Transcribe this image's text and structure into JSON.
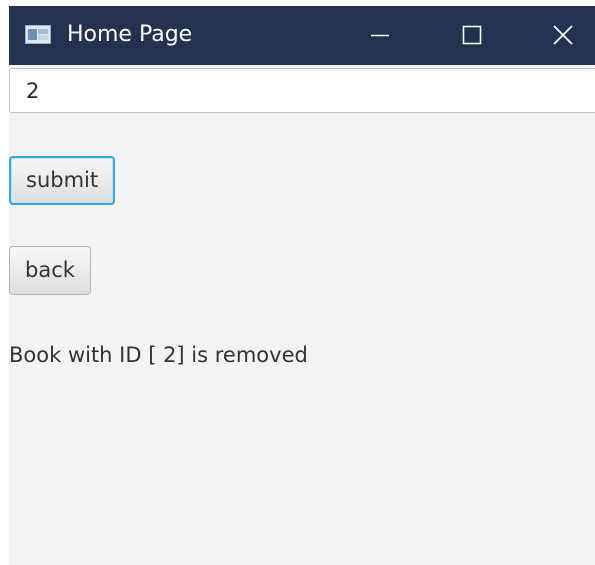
{
  "window": {
    "title": "Home Page",
    "icon": "app-window-icon",
    "controls": {
      "minimize_icon": "minimize-icon",
      "maximize_icon": "maximize-icon",
      "close_icon": "close-icon"
    },
    "titlebar_color": "#22324f",
    "background_color": "#f3f3f4"
  },
  "form": {
    "id_input_value": "2",
    "submit_label": "submit",
    "back_label": "back",
    "focus_color": "#3ba5e0"
  },
  "status": {
    "message": "Book with ID [ 2] is removed"
  }
}
